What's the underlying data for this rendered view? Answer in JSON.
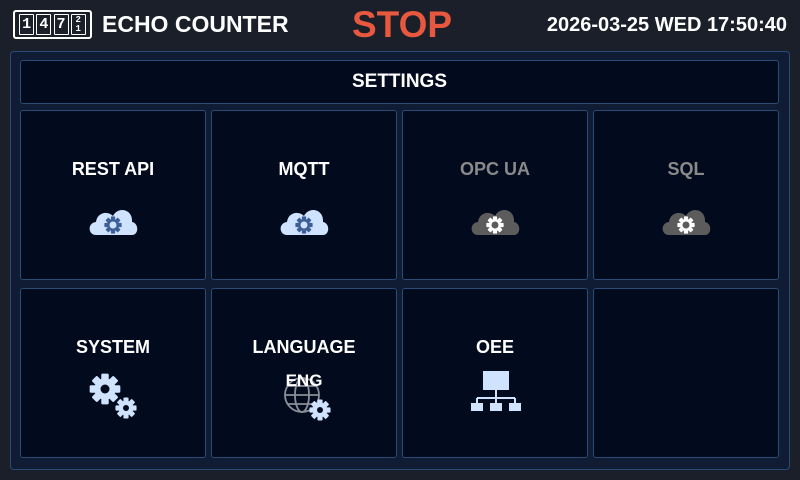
{
  "topbar": {
    "logo_digits": [
      "1",
      "4",
      "7"
    ],
    "logo_split_digit": [
      "2",
      "1"
    ],
    "app_name": "ECHO COUNTER",
    "status": "STOP",
    "status_color": "#e8583e",
    "datetime": "2026-03-25 WED 17:50:40"
  },
  "settings": {
    "title": "SETTINGS",
    "tiles": [
      {
        "label": "REST API",
        "icon": "cloud-gear-icon",
        "enabled": true
      },
      {
        "label": "MQTT",
        "icon": "cloud-gear-icon",
        "enabled": true
      },
      {
        "label": "OPC UA",
        "icon": "cloud-gear-icon",
        "enabled": false
      },
      {
        "label": "SQL",
        "icon": "cloud-gear-icon",
        "enabled": false
      },
      {
        "label": "SYSTEM",
        "icon": "gears-icon",
        "enabled": true
      },
      {
        "label": "LANGUAGE",
        "sub": "ENG",
        "icon": "globe-gear-icon",
        "enabled": true
      },
      {
        "label": "OEE",
        "icon": "network-icon",
        "enabled": true
      },
      {
        "label": "",
        "icon": "",
        "enabled": true
      }
    ]
  },
  "colors": {
    "background": "#1a1f2a",
    "panel": "#0f1c33",
    "tile": "#020b1d",
    "border": "#2a4a78",
    "icon_active": "#cfe3ff",
    "icon_disabled": "#5c5c5c"
  }
}
